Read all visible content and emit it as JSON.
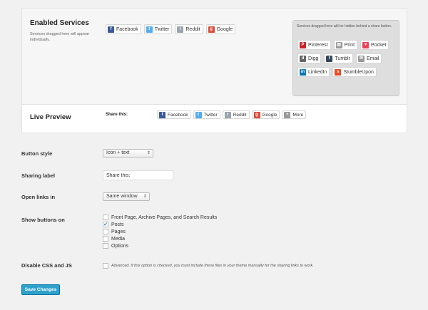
{
  "enabled_services": {
    "title": "Enabled Services",
    "description": "Services dragged here will appear individually.",
    "buttons": [
      {
        "label": "Facebook",
        "icon": "facebook-icon",
        "glyph": "f",
        "color": "#3b5998"
      },
      {
        "label": "Twitter",
        "icon": "twitter-icon",
        "glyph": "t",
        "color": "#55acee"
      },
      {
        "label": "Reddit",
        "icon": "reddit-icon",
        "glyph": "r",
        "color": "#9aa4ad"
      },
      {
        "label": "Google",
        "icon": "google-icon",
        "glyph": "g",
        "color": "#dd4b39"
      }
    ]
  },
  "hidden_services": {
    "description": "Services dragged here will be hidden behind a share button.",
    "buttons": [
      {
        "label": "Pinterest",
        "icon": "pinterest-icon",
        "glyph": "P",
        "color": "#cb2027"
      },
      {
        "label": "Print",
        "icon": "print-icon",
        "glyph": "▤",
        "color": "#999999"
      },
      {
        "label": "Pocket",
        "icon": "pocket-icon",
        "glyph": "♥",
        "color": "#ee4056"
      },
      {
        "label": "Digg",
        "icon": "digg-icon",
        "glyph": "d",
        "color": "#666666"
      },
      {
        "label": "Tumblr",
        "icon": "tumblr-icon",
        "glyph": "t",
        "color": "#35465c"
      },
      {
        "label": "Email",
        "icon": "email-icon",
        "glyph": "✉",
        "color": "#999999"
      },
      {
        "label": "LinkedIn",
        "icon": "linkedin-icon",
        "glyph": "in",
        "color": "#0976b4"
      },
      {
        "label": "StumbleUpon",
        "icon": "stumbleupon-icon",
        "glyph": "s",
        "color": "#eb4924"
      }
    ]
  },
  "live_preview": {
    "title": "Live Preview",
    "share_label": "Share this:",
    "buttons": [
      {
        "label": "Facebook",
        "icon": "facebook-icon",
        "glyph": "f",
        "color": "#3b5998"
      },
      {
        "label": "Twitter",
        "icon": "twitter-icon",
        "glyph": "t",
        "color": "#55acee"
      },
      {
        "label": "Reddit",
        "icon": "reddit-icon",
        "glyph": "r",
        "color": "#9aa4ad"
      },
      {
        "label": "Google",
        "icon": "google-icon",
        "glyph": "g",
        "color": "#dd4b39"
      },
      {
        "label": "More",
        "icon": "more-icon",
        "glyph": "+",
        "color": "#999999"
      }
    ]
  },
  "settings": {
    "button_style": {
      "label": "Button style",
      "value": "Icon + text"
    },
    "sharing_label": {
      "label": "Sharing label",
      "value": "Share this:"
    },
    "open_links": {
      "label": "Open links in",
      "value": "Same window"
    },
    "show_buttons": {
      "label": "Show buttons on",
      "options": [
        {
          "label": "Front Page, Archive Pages, and Search Results",
          "checked": false
        },
        {
          "label": "Posts",
          "checked": true
        },
        {
          "label": "Pages",
          "checked": false
        },
        {
          "label": "Media",
          "checked": false
        },
        {
          "label": "Options",
          "checked": false
        }
      ]
    },
    "disable_css": {
      "label": "Disable CSS and JS",
      "checked": false,
      "help": "Advanced. If this option is checked, you must include these files in your theme manually for the sharing links to work."
    }
  },
  "save_button": {
    "label": "Save Changes"
  }
}
